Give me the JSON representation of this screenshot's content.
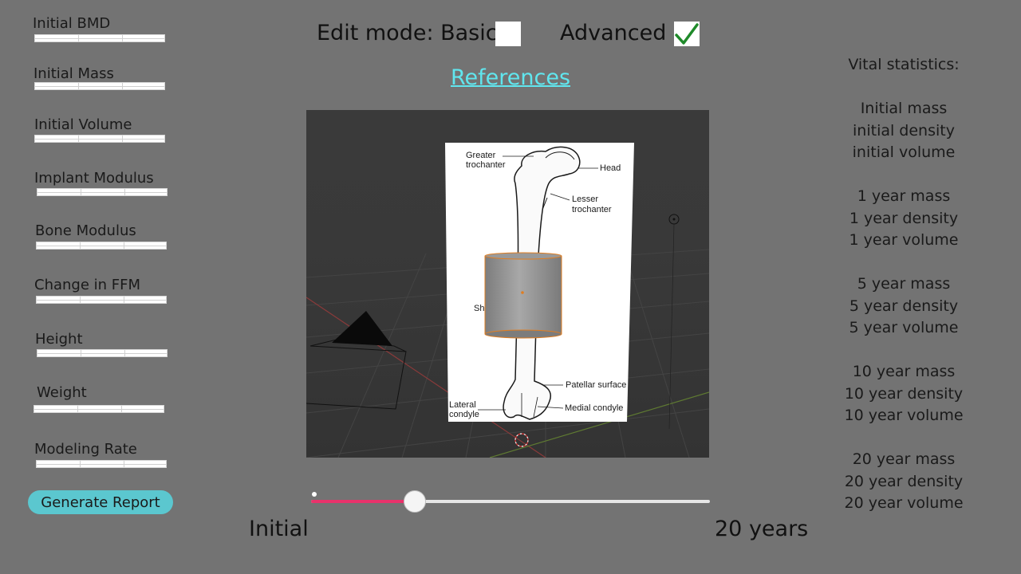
{
  "fields": [
    {
      "label": "Initial BMD"
    },
    {
      "label": "Initial Mass"
    },
    {
      "label": "Initial Volume"
    },
    {
      "label": "Implant Modulus"
    },
    {
      "label": "Bone Modulus"
    },
    {
      "label": "Change in FFM"
    },
    {
      "label": "Height"
    },
    {
      "label": "Weight"
    },
    {
      "label": "Modeling Rate"
    }
  ],
  "generate_report": "Generate Report",
  "edit_mode": {
    "basic_label": "Edit mode: Basic",
    "basic_checked": false,
    "advanced_label": "Advanced",
    "advanced_checked": true
  },
  "references_link": "References",
  "bone_image": {
    "labels": {
      "greater_trochanter": [
        "Greater",
        "trochanter"
      ],
      "head": "Head",
      "lesser_trochanter": [
        "Lesser",
        "trochanter"
      ],
      "shaft_partial": "Sh",
      "patellar_surface": "Patellar surface",
      "lateral_condyle": [
        "Lateral",
        "condyle"
      ],
      "medial_condyle": "Medial condyle"
    }
  },
  "vital_stats": {
    "title": "Vital statistics:",
    "groups": [
      [
        "Initial mass",
        "initial density",
        "initial volume"
      ],
      [
        "1 year mass",
        "1 year density",
        "1 year volume"
      ],
      [
        "5 year mass",
        "5 year density",
        "5 year volume"
      ],
      [
        "10 year mass",
        "10 year density",
        "10 year volume"
      ],
      [
        "20 year mass",
        "20 year density",
        "20 year volume"
      ]
    ]
  },
  "timeline": {
    "start_label": "Initial",
    "end_label": "20 years",
    "value_fraction": 0.26
  },
  "colors": {
    "background": "#737373",
    "accent_button": "#5bc7cf",
    "link": "#60e6ee",
    "slider_fill": "#e8336b",
    "check": "#1f8a2a"
  }
}
